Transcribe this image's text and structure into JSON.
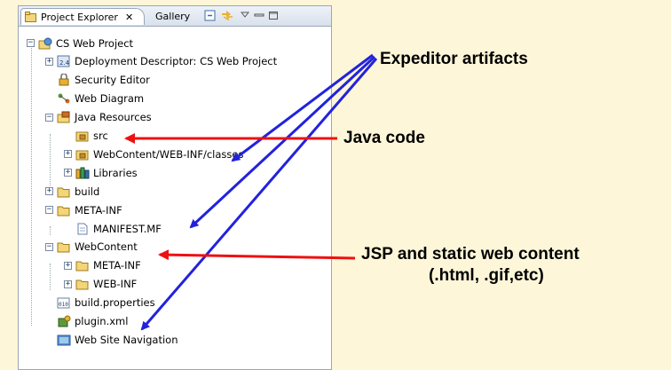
{
  "tabs": {
    "active_label": "Project Explorer",
    "close_glyph": "✕",
    "inactive_label": "Gallery"
  },
  "tree": [
    {
      "label": "CS Web Project",
      "icon": "web-project-icon",
      "toggle": "−"
    },
    {
      "label": "Deployment Descriptor: CS Web Project",
      "icon": "deployment-descriptor-icon",
      "toggle": "+"
    },
    {
      "label": "Security Editor",
      "icon": "security-editor-icon",
      "toggle": ""
    },
    {
      "label": "Web Diagram",
      "icon": "web-diagram-icon",
      "toggle": ""
    },
    {
      "label": "Java Resources",
      "icon": "java-resources-icon",
      "toggle": "−"
    },
    {
      "label": "src",
      "icon": "package-folder-icon",
      "toggle": ""
    },
    {
      "label": "WebContent/WEB-INF/classes",
      "icon": "package-folder-icon",
      "toggle": "+"
    },
    {
      "label": "Libraries",
      "icon": "libraries-icon",
      "toggle": "+"
    },
    {
      "label": "build",
      "icon": "folder-icon",
      "toggle": "+"
    },
    {
      "label": "META-INF",
      "icon": "folder-icon",
      "toggle": "−"
    },
    {
      "label": "MANIFEST.MF",
      "icon": "file-icon",
      "toggle": ""
    },
    {
      "label": "WebContent",
      "icon": "folder-icon",
      "toggle": "−"
    },
    {
      "label": "META-INF",
      "icon": "folder-icon",
      "toggle": "+"
    },
    {
      "label": "WEB-INF",
      "icon": "folder-icon",
      "toggle": "+"
    },
    {
      "label": "build.properties",
      "icon": "properties-file-icon",
      "toggle": ""
    },
    {
      "label": "plugin.xml",
      "icon": "plugin-icon",
      "toggle": ""
    },
    {
      "label": "Web Site Navigation",
      "icon": "site-navigation-icon",
      "toggle": ""
    }
  ],
  "callouts": {
    "expeditor": "Expeditor artifacts",
    "java_code": "Java code",
    "jsp_line1": "JSP and static web content",
    "jsp_line2": "(.html, .gif,etc)"
  },
  "colors": {
    "background": "#fdf6d8",
    "blue_arrow": "#2222dd",
    "red_arrow": "#ee1111",
    "folder": "#e8c25a"
  }
}
